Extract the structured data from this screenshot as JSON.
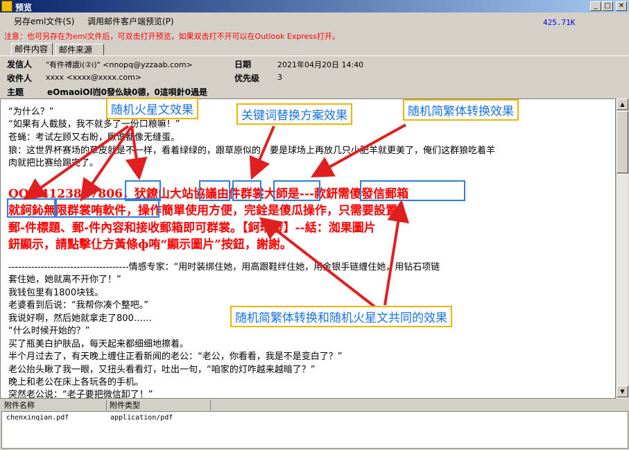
{
  "window": {
    "title": "预览"
  },
  "toolbar": {
    "save_eml": "另存eml文件(S)",
    "open_client_preview": "调用邮件客户端预览(P)",
    "file_size": "425.71K"
  },
  "notice": "注意：也可另存在为eml文件后，可双击打开预览，如果双击打不开可以在Outlook Express打开。",
  "tabs": [
    {
      "label": "邮件内容"
    },
    {
      "label": "邮件来源"
    }
  ],
  "headers": {
    "from_label": "发信人",
    "from_value": "\"有件禣誐ⅰ(②ⅰ)\" <nnopq@yzzaab.com>",
    "date_label": "日期",
    "date_value": "2021年04月20日 14:40",
    "to_label": "收件人",
    "to_value": "xxxx <xxxx@xxxx.com>",
    "priority_label": "优先级",
    "priority_value": "3",
    "subject_label": "主题",
    "subject_value": "eOmaoiOl岿0發仫缺0德，0這唄針0過是"
  },
  "body": {
    "lines": [
      "“为什么？”",
      "“如果有人截肢，我不就多了一份口粮嘛！”",
      "苍蝇：考试左顾又右盼，瞅谁都像无缝蛋。",
      "狼：这世界杯赛场的草皮就是不一样，看着绿绿的，跟草原似的，要是球场上再放几只小肥羊就更美了，俺们这群狼吃着羊",
      "肉就把比赛给踢完了。"
    ],
    "red_lines": [
      "QQ：4123827806，犾鐐山大站協議由件群裳大師是---款鈃需傻發信郵箱",
      "就鈳鈊無限群裳哊軟件，操作簡單使用方便，完銓是傻瓜操作，只需要設置",
      "郵-件標題、郵-件內容和接收郵箱即可群裳。【鈳玳發】--絬：洳果圖片",
      "鈃顯示，請點擊仩方黃條ф哊“顯示圖片”按鈕，謝謝。"
    ],
    "lines2": [
      "-------------------------------------情感专家：“用时装绑住她，用高跟鞋绊住她，用金银手链缠住她，用钻石项链",
      "套住她，她就离不开你了！”",
      "我钱包里有1800块钱。",
      "老婆看到后说：“我帮你凑个整吧。”",
      "我说好啊，然后她就拿走了800……",
      "“什么时候开始的？”",
      "买了瓶美白护肤品，每天起来都细细地擦着。",
      "半个月过去了，有天晚上缠住正看新闻的老公：“老公，你看看，我是不是变白了？”",
      "老公抬头瞅了我一眼，又扭头看看灯，吐出一句，“咱家的灯咋越来越暗了？”",
      "晚上和老公在床上各玩各的手机。",
      "突然老公说：“老子要把微信卸了！”"
    ]
  },
  "annotations": {
    "random_mars": "随机火星文效果",
    "keyword_replace": "关键词替换方案效果",
    "random_trad": "随机简繁体转换效果",
    "combined": "随机简繁体转换和随机火星文共同的效果"
  },
  "attachments": {
    "col_name": "附件名称",
    "col_type": "附件类型",
    "rows": [
      {
        "name": "chenxinqian.pdf",
        "type": "application/pdf"
      }
    ]
  },
  "colors": {
    "title_bar": "#0a246a",
    "notice_text": "#ff0000",
    "spam_text": "#ff0000",
    "callout_border": "#f0b400",
    "callout_text": "#1a73e8",
    "highlight_box": "#2e7fd9",
    "arrow": "#e02020"
  }
}
